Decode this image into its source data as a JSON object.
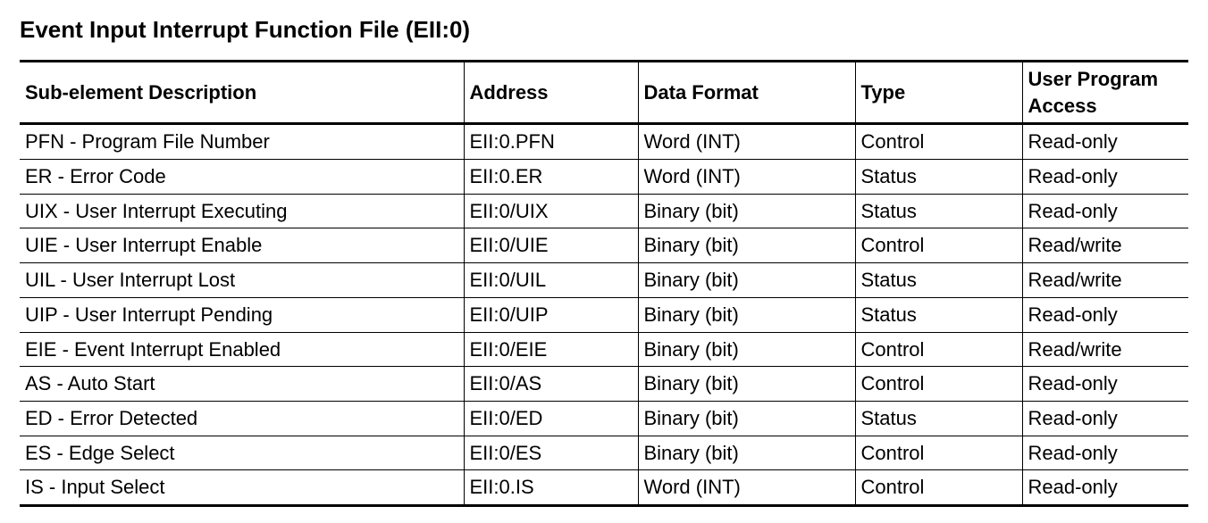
{
  "title": "Event Input Interrupt Function File (EII:0)",
  "chart_data": {
    "type": "table",
    "columns": [
      "Sub-element Description",
      "Address",
      "Data Format",
      "Type",
      "User Program Access"
    ],
    "rows": [
      {
        "desc": "PFN - Program File Number",
        "address": "EII:0.PFN",
        "format": "Word (INT)",
        "type": "Control",
        "access": "Read-only"
      },
      {
        "desc": "ER - Error Code",
        "address": "EII:0.ER",
        "format": "Word (INT)",
        "type": "Status",
        "access": "Read-only"
      },
      {
        "desc": "UIX - User Interrupt Executing",
        "address": "EII:0/UIX",
        "format": "Binary (bit)",
        "type": "Status",
        "access": "Read-only"
      },
      {
        "desc": "UIE - User Interrupt Enable",
        "address": "EII:0/UIE",
        "format": "Binary (bit)",
        "type": "Control",
        "access": "Read/write"
      },
      {
        "desc": "UIL - User Interrupt Lost",
        "address": "EII:0/UIL",
        "format": "Binary (bit)",
        "type": "Status",
        "access": "Read/write"
      },
      {
        "desc": "UIP - User Interrupt Pending",
        "address": "EII:0/UIP",
        "format": "Binary (bit)",
        "type": "Status",
        "access": "Read-only"
      },
      {
        "desc": "EIE - Event Interrupt Enabled",
        "address": "EII:0/EIE",
        "format": "Binary (bit)",
        "type": "Control",
        "access": "Read/write"
      },
      {
        "desc": "AS - Auto Start",
        "address": "EII:0/AS",
        "format": "Binary (bit)",
        "type": "Control",
        "access": "Read-only"
      },
      {
        "desc": "ED - Error Detected",
        "address": "EII:0/ED",
        "format": "Binary (bit)",
        "type": "Status",
        "access": "Read-only"
      },
      {
        "desc": "ES - Edge Select",
        "address": "EII:0/ES",
        "format": "Binary (bit)",
        "type": "Control",
        "access": "Read-only"
      },
      {
        "desc": "IS - Input Select",
        "address": "EII:0.IS",
        "format": "Word (INT)",
        "type": "Control",
        "access": "Read-only"
      }
    ]
  }
}
